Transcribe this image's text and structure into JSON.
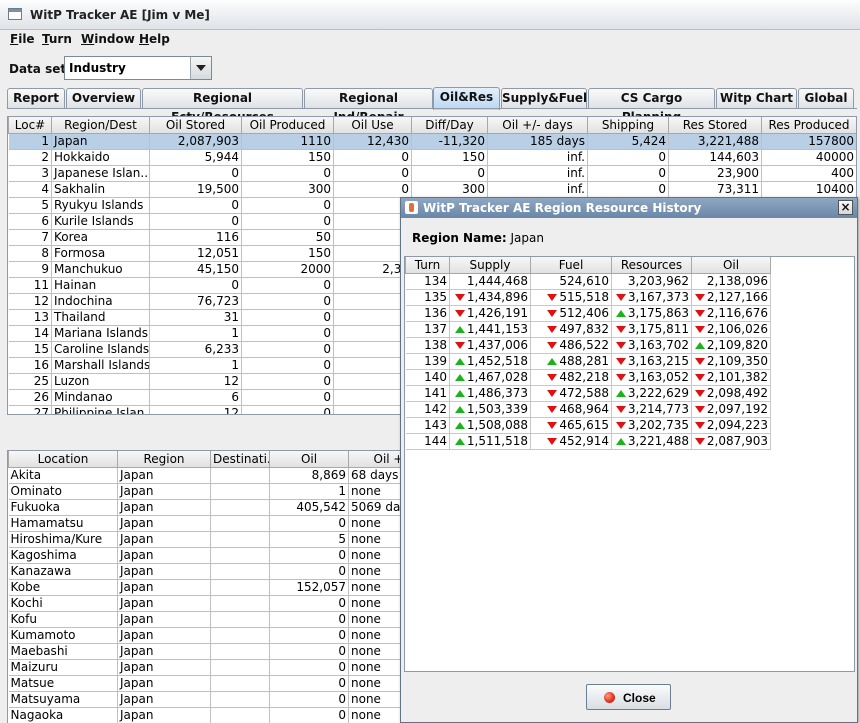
{
  "window": {
    "title": "WitP Tracker AE [Jim v Me]"
  },
  "menus": [
    "File",
    "Turn",
    "Window",
    "Help"
  ],
  "menu_underlines": [
    "F",
    "T",
    "W",
    "H"
  ],
  "dataset": {
    "label": "Data set:",
    "value": "Industry"
  },
  "tabs": [
    "Report",
    "Overview",
    "Regional Fcty/Resources",
    "Regional Ind/Repair",
    "Oil&Res",
    "Supply&Fuel",
    "CS Cargo Planning",
    "Witp Chart",
    "Global"
  ],
  "active_tab": "Oil&Res",
  "region_table": {
    "columns": [
      "Loc#",
      "Region/Dest",
      "Oil Stored",
      "Oil Produced",
      "Oil Use",
      "Diff/Day",
      "Oil +/- days",
      "Shipping",
      "Res Stored",
      "Res Produced"
    ],
    "rows": [
      [
        "1",
        "Japan",
        "2,087,903",
        "1110",
        "12,430",
        "-11,320",
        "185 days",
        "5,424",
        "3,221,488",
        "157800"
      ],
      [
        "2",
        "Hokkaido",
        "5,944",
        "150",
        "0",
        "150",
        "inf.",
        "0",
        "144,603",
        "40000"
      ],
      [
        "3",
        "Japanese Islan...",
        "0",
        "0",
        "0",
        "0",
        "inf.",
        "0",
        "23,900",
        "400"
      ],
      [
        "4",
        "Sakhalin",
        "19,500",
        "300",
        "0",
        "300",
        "inf.",
        "0",
        "73,311",
        "10400"
      ],
      [
        "5",
        "Ryukyu Islands",
        "0",
        "0",
        "",
        "",
        "",
        "",
        "",
        ""
      ],
      [
        "6",
        "Kurile Islands",
        "0",
        "0",
        "",
        "",
        "",
        "",
        "",
        ""
      ],
      [
        "7",
        "Korea",
        "116",
        "50",
        "",
        "",
        "",
        "",
        "",
        ""
      ],
      [
        "8",
        "Formosa",
        "12,051",
        "150",
        "",
        "",
        "",
        "",
        "",
        ""
      ],
      [
        "9",
        "Manchukuo",
        "45,150",
        "2000",
        "2,30",
        "",
        "",
        "",
        "",
        ""
      ],
      [
        "11",
        "Hainan",
        "0",
        "0",
        "",
        "",
        "",
        "",
        "",
        ""
      ],
      [
        "12",
        "Indochina",
        "76,723",
        "0",
        "",
        "",
        "",
        "",
        "",
        ""
      ],
      [
        "13",
        "Thailand",
        "31",
        "0",
        "",
        "",
        "",
        "",
        "",
        ""
      ],
      [
        "14",
        "Mariana Islands",
        "1",
        "0",
        "",
        "",
        "",
        "",
        "",
        ""
      ],
      [
        "15",
        "Caroline Islands",
        "6,233",
        "0",
        "",
        "",
        "",
        "",
        "",
        ""
      ],
      [
        "16",
        "Marshall Islands",
        "1",
        "0",
        "",
        "",
        "",
        "",
        "",
        ""
      ],
      [
        "25",
        "Luzon",
        "12",
        "0",
        "",
        "",
        "",
        "",
        "",
        ""
      ],
      [
        "26",
        "Mindanao",
        "6",
        "0",
        "",
        "",
        "",
        "",
        "",
        ""
      ],
      [
        "27",
        "Philippine Islan...",
        "12",
        "0",
        "",
        "",
        "",
        "",
        "",
        ""
      ]
    ]
  },
  "location_table": {
    "columns": [
      "Location",
      "Region",
      "Destinati...",
      "Oil",
      "Oil +"
    ],
    "rows": [
      [
        "Akita",
        "Japan",
        "",
        "8,869",
        "68 days"
      ],
      [
        "Ominato",
        "Japan",
        "",
        "1",
        "none"
      ],
      [
        "Fukuoka",
        "Japan",
        "",
        "405,542",
        "5069 day"
      ],
      [
        "Hamamatsu",
        "Japan",
        "",
        "0",
        "none"
      ],
      [
        "Hiroshima/Kure",
        "Japan",
        "",
        "5",
        "none"
      ],
      [
        "Kagoshima",
        "Japan",
        "",
        "0",
        "none"
      ],
      [
        "Kanazawa",
        "Japan",
        "",
        "0",
        "none"
      ],
      [
        "Kobe",
        "Japan",
        "",
        "152,057",
        "none"
      ],
      [
        "Kochi",
        "Japan",
        "",
        "0",
        "none"
      ],
      [
        "Kofu",
        "Japan",
        "",
        "0",
        "none"
      ],
      [
        "Kumamoto",
        "Japan",
        "",
        "0",
        "none"
      ],
      [
        "Maebashi",
        "Japan",
        "",
        "0",
        "none"
      ],
      [
        "Maizuru",
        "Japan",
        "",
        "0",
        "none"
      ],
      [
        "Matsue",
        "Japan",
        "",
        "0",
        "none"
      ],
      [
        "Matsuyama",
        "Japan",
        "",
        "0",
        "none"
      ],
      [
        "Nagaoka",
        "Japan",
        "",
        "0",
        "none"
      ]
    ]
  },
  "dialog": {
    "title": "WitP Tracker AE Region Resource History",
    "region_label": "Region Name:",
    "region_value": "Japan",
    "columns": [
      "Turn",
      "Supply",
      "Fuel",
      "Resources",
      "Oil"
    ],
    "rows": [
      {
        "turn": "134",
        "cells": [
          [
            "",
            "1,444,468"
          ],
          [
            "",
            "524,610"
          ],
          [
            "",
            "3,203,962"
          ],
          [
            "",
            "2,138,096"
          ]
        ]
      },
      {
        "turn": "135",
        "cells": [
          [
            "down",
            "1,434,896"
          ],
          [
            "down",
            "515,518"
          ],
          [
            "down",
            "3,167,373"
          ],
          [
            "down",
            "2,127,166"
          ]
        ]
      },
      {
        "turn": "136",
        "cells": [
          [
            "down",
            "1,426,191"
          ],
          [
            "down",
            "512,406"
          ],
          [
            "up",
            "3,175,863"
          ],
          [
            "down",
            "2,116,676"
          ]
        ]
      },
      {
        "turn": "137",
        "cells": [
          [
            "up",
            "1,441,153"
          ],
          [
            "down",
            "497,832"
          ],
          [
            "down",
            "3,175,811"
          ],
          [
            "down",
            "2,106,026"
          ]
        ]
      },
      {
        "turn": "138",
        "cells": [
          [
            "down",
            "1,437,006"
          ],
          [
            "down",
            "486,522"
          ],
          [
            "down",
            "3,163,702"
          ],
          [
            "up",
            "2,109,820"
          ]
        ]
      },
      {
        "turn": "139",
        "cells": [
          [
            "up",
            "1,452,518"
          ],
          [
            "up",
            "488,281"
          ],
          [
            "down",
            "3,163,215"
          ],
          [
            "down",
            "2,109,350"
          ]
        ]
      },
      {
        "turn": "140",
        "cells": [
          [
            "up",
            "1,467,028"
          ],
          [
            "down",
            "482,218"
          ],
          [
            "down",
            "3,163,052"
          ],
          [
            "down",
            "2,101,382"
          ]
        ]
      },
      {
        "turn": "141",
        "cells": [
          [
            "up",
            "1,486,373"
          ],
          [
            "down",
            "472,588"
          ],
          [
            "up",
            "3,222,629"
          ],
          [
            "down",
            "2,098,492"
          ]
        ]
      },
      {
        "turn": "142",
        "cells": [
          [
            "up",
            "1,503,339"
          ],
          [
            "down",
            "468,964"
          ],
          [
            "down",
            "3,214,773"
          ],
          [
            "down",
            "2,097,192"
          ]
        ]
      },
      {
        "turn": "143",
        "cells": [
          [
            "up",
            "1,508,088"
          ],
          [
            "down",
            "465,615"
          ],
          [
            "down",
            "3,202,735"
          ],
          [
            "down",
            "2,094,223"
          ]
        ]
      },
      {
        "turn": "144",
        "cells": [
          [
            "up",
            "1,511,518"
          ],
          [
            "down",
            "452,914"
          ],
          [
            "up",
            "3,221,488"
          ],
          [
            "down",
            "2,087,903"
          ]
        ]
      }
    ],
    "close_label": "Close"
  },
  "colors": {
    "selection": "#b8cfe5",
    "up_arrow": "#1bb31b",
    "down_arrow": "#e01010",
    "title_bar": "#6a87a8"
  },
  "icons": [
    "window-icon",
    "dropdown-arrow-icon",
    "java-cup-icon",
    "close-x-icon",
    "red-dot-icon",
    "up-arrow-icon",
    "down-arrow-icon"
  ]
}
